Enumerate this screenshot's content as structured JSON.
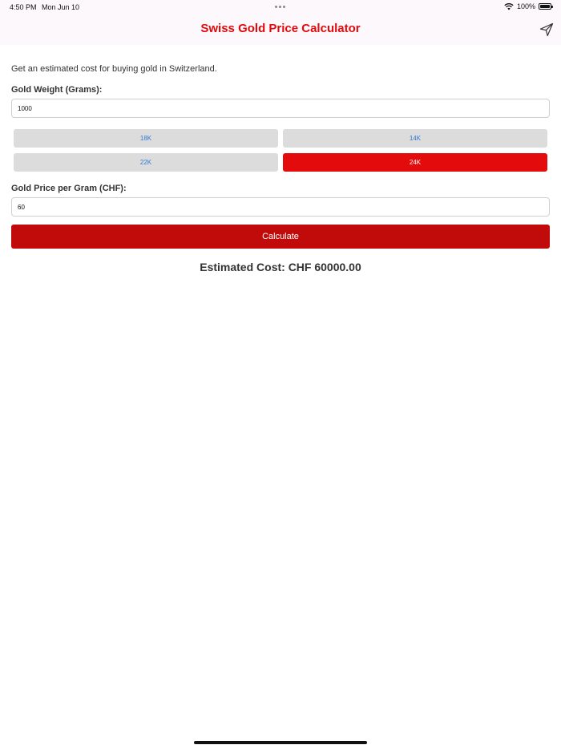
{
  "status_bar": {
    "time": "4:50 PM",
    "date": "Mon Jun 10",
    "battery": "100%"
  },
  "nav": {
    "title": "Swiss Gold Price Calculator",
    "share_icon": "paper-plane-icon"
  },
  "colors": {
    "accent": "#e00a0a",
    "calculate_button": "#c10b0b",
    "selected_karat": "#e30b0b",
    "karat_text": "#2f7ad7",
    "karat_bg": "#dcdcdc"
  },
  "form": {
    "intro": "Get an estimated cost for buying gold in Switzerland.",
    "weight_label": "Gold Weight (Grams):",
    "weight_value": "1000",
    "karats": [
      {
        "label": "18K",
        "selected": false
      },
      {
        "label": "14K",
        "selected": false
      },
      {
        "label": "22K",
        "selected": false
      },
      {
        "label": "24K",
        "selected": true
      }
    ],
    "price_label": "Gold Price per Gram (CHF):",
    "price_value": "60",
    "calculate_label": "Calculate",
    "result": "Estimated Cost: CHF 60000.00"
  }
}
